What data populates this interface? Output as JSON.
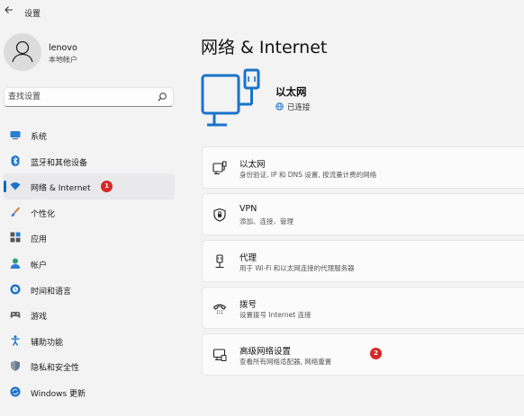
{
  "window": {
    "title": "设置",
    "back_icon": "back-arrow-icon"
  },
  "user": {
    "name": "lenovo",
    "account_type": "本地帐户"
  },
  "search": {
    "placeholder": "查找设置",
    "value": ""
  },
  "sidebar": {
    "items": [
      {
        "label": "系统",
        "icon": "monitor-icon",
        "active": false
      },
      {
        "label": "蓝牙和其他设备",
        "icon": "bluetooth-icon",
        "active": false
      },
      {
        "label": "网络 & Internet",
        "icon": "wifi-icon",
        "active": true,
        "badge": "1"
      },
      {
        "label": "个性化",
        "icon": "brush-icon",
        "active": false
      },
      {
        "label": "应用",
        "icon": "apps-icon",
        "active": false
      },
      {
        "label": "帐户",
        "icon": "person-icon",
        "active": false
      },
      {
        "label": "时间和语言",
        "icon": "globe-clock-icon",
        "active": false
      },
      {
        "label": "游戏",
        "icon": "gamepad-icon",
        "active": false
      },
      {
        "label": "辅助功能",
        "icon": "accessibility-icon",
        "active": false
      },
      {
        "label": "隐私和安全性",
        "icon": "shield-icon",
        "active": false
      },
      {
        "label": "Windows 更新",
        "icon": "update-icon",
        "active": false
      }
    ]
  },
  "main": {
    "title": "网络 & Internet",
    "hero": {
      "name": "以太网",
      "status": "已连接",
      "icon": "ethernet-computer-icon"
    },
    "cards": [
      {
        "title": "以太网",
        "desc": "身份验证, IP 和 DNS 设置, 按流量计费的网络",
        "icon": "ethernet-icon"
      },
      {
        "title": "VPN",
        "desc": "添加、连接、管理",
        "icon": "vpn-shield-icon"
      },
      {
        "title": "代理",
        "desc": "用于 Wi-Fi 和以太网连接的代理服务器",
        "icon": "proxy-icon"
      },
      {
        "title": "拨号",
        "desc": "设置拨号 Internet 连接",
        "icon": "dialup-icon"
      },
      {
        "title": "高级网络设置",
        "desc": "查看所有网络适配器, 网络重置",
        "icon": "advanced-network-icon",
        "badge": "2"
      }
    ]
  },
  "colors": {
    "accent": "#0067c0",
    "background": "#f3f3f3",
    "badge": "#d62828"
  }
}
